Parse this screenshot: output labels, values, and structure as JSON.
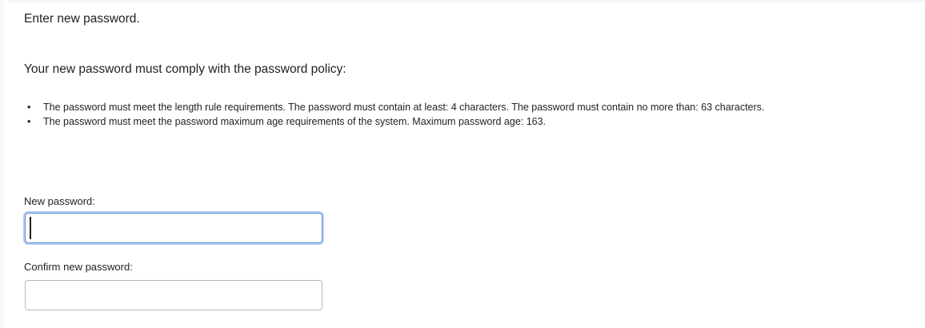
{
  "form": {
    "heading": "Enter new password.",
    "policy_intro": "Your new password must comply with the password policy:",
    "rules": [
      "The password must meet the length rule requirements. The password must contain at least: 4 characters. The password must contain no more than: 63 characters.",
      "The password must meet the password maximum age requirements of the system. Maximum password age: 163."
    ],
    "new_password_label": "New password:",
    "new_password_value": "",
    "confirm_password_label": "Confirm new password:",
    "confirm_password_value": ""
  }
}
